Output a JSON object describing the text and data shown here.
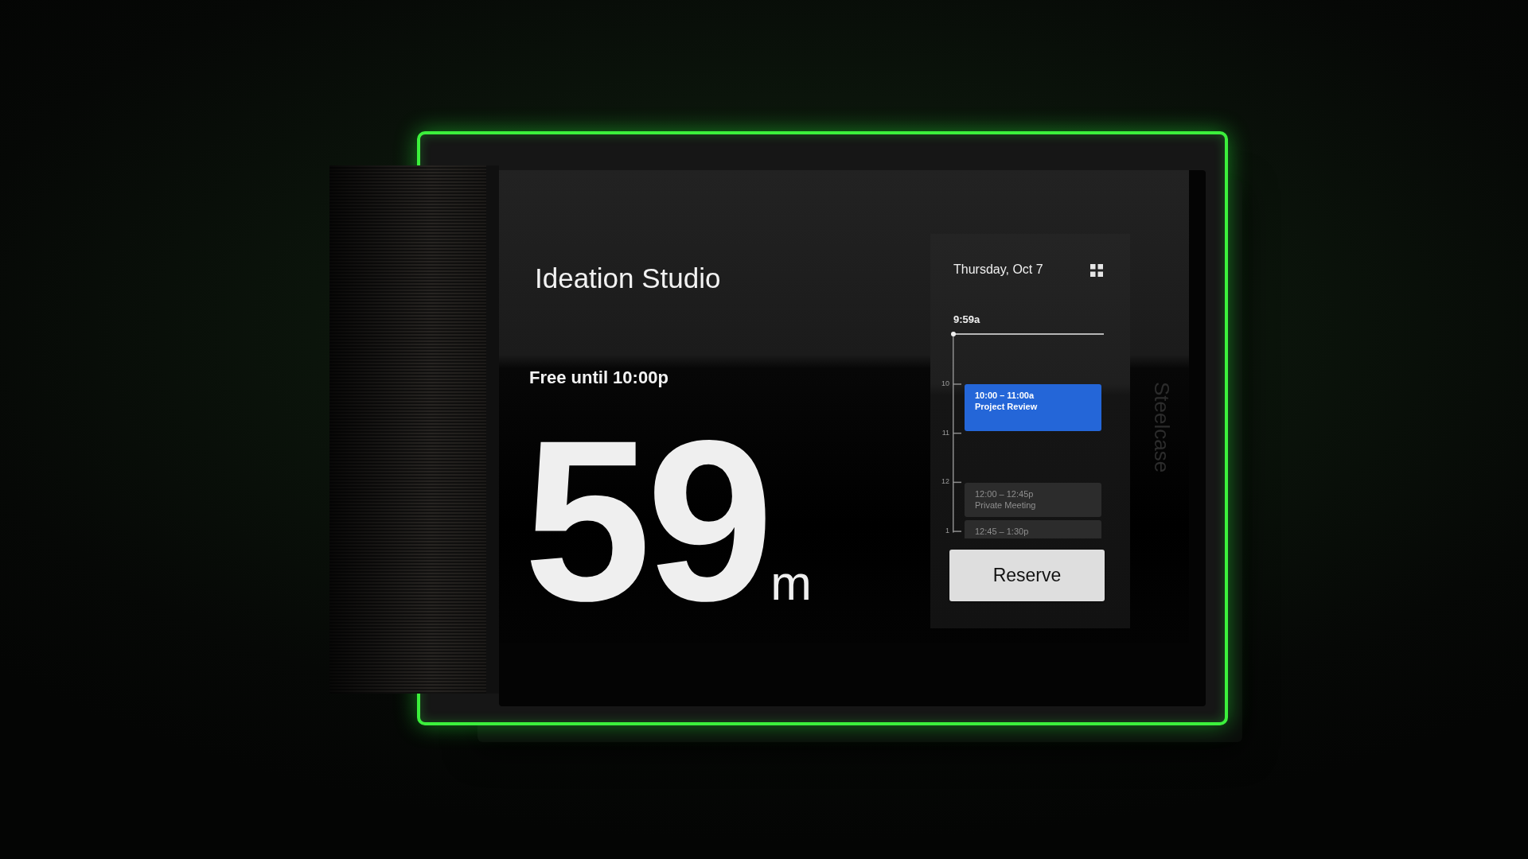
{
  "device": {
    "brand_label": "Steelcase"
  },
  "room": {
    "name": "Ideation Studio",
    "status": "Free until 10:00p",
    "countdown": {
      "value": "59",
      "unit": "m"
    }
  },
  "calendar": {
    "date": "Thursday, Oct 7",
    "current_time": "9:59a",
    "hours": [
      "10",
      "11",
      "12",
      "1"
    ],
    "events": [
      {
        "time": "10:00 – 11:00a",
        "title": "Project Review",
        "highlighted": true
      },
      {
        "time": "12:00 – 12:45p",
        "title": "Private Meeting",
        "highlighted": false
      },
      {
        "time": "12:45 – 1:30p",
        "highlighted": false
      }
    ]
  },
  "reserve_button": {
    "label": "Reserve"
  }
}
